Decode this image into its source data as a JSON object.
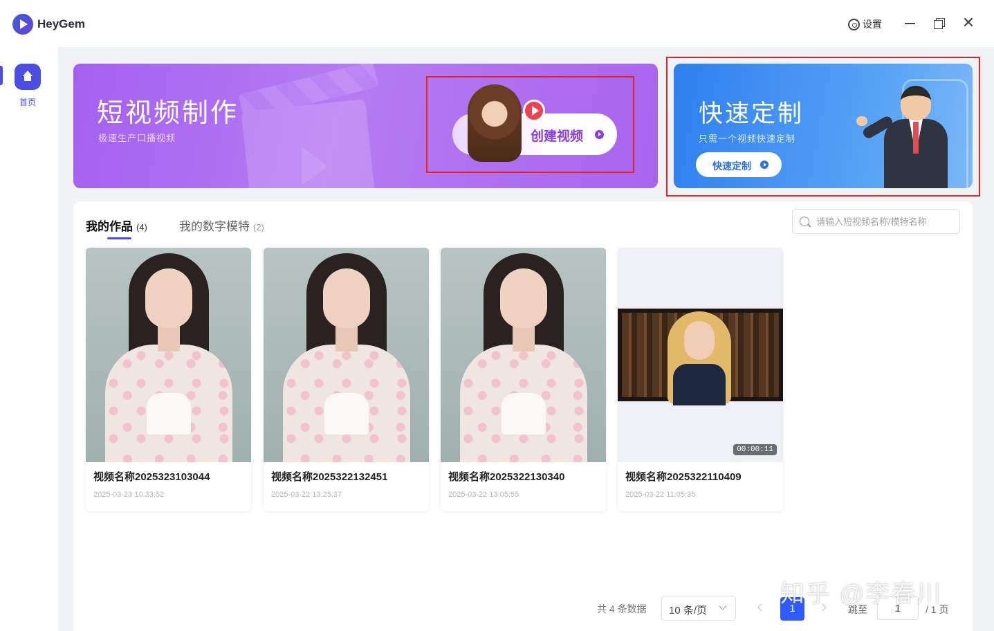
{
  "app": {
    "name": "HeyGem",
    "settings_label": "设置"
  },
  "sidebar": {
    "items": [
      {
        "label": "首页",
        "active": true
      }
    ]
  },
  "banners": {
    "short_video": {
      "title": "短视频制作",
      "subtitle": "极速生产口播视频",
      "button": "创建视频"
    },
    "quick_custom": {
      "title": "快速定制",
      "subtitle": "只需一个视频快速定制",
      "button": "快速定制"
    }
  },
  "tabs": [
    {
      "label": "我的作品",
      "count": "(4)",
      "active": true
    },
    {
      "label": "我的数字模特",
      "count": "(2)",
      "active": false
    }
  ],
  "search": {
    "placeholder": "请输入短视频名称/模特名称"
  },
  "videos": [
    {
      "title": "视频名称2025323103044",
      "date": "2025-03-23 10:33:52",
      "thumb": "portrait"
    },
    {
      "title": "视频名称2025322132451",
      "date": "2025-03-22 13:25:37",
      "thumb": "portrait"
    },
    {
      "title": "视频名称2025322130340",
      "date": "2025-03-22 13:05:55",
      "thumb": "portrait"
    },
    {
      "title": "视频名称2025322110409",
      "date": "2025-03-22 11:05:35",
      "thumb": "letterbox",
      "duration": "00:00:11"
    }
  ],
  "pagination": {
    "total": "共 4 条数据",
    "page_size": "10 条/页",
    "current_page": "1",
    "jump_label": "跳至",
    "jump_value": "1",
    "total_pages": "/ 1 页"
  },
  "watermark": "知乎 @李春川",
  "colors": {
    "accent": "#4c4de2",
    "highlight_box": "#e02424",
    "page_active": "#2d5bff"
  }
}
